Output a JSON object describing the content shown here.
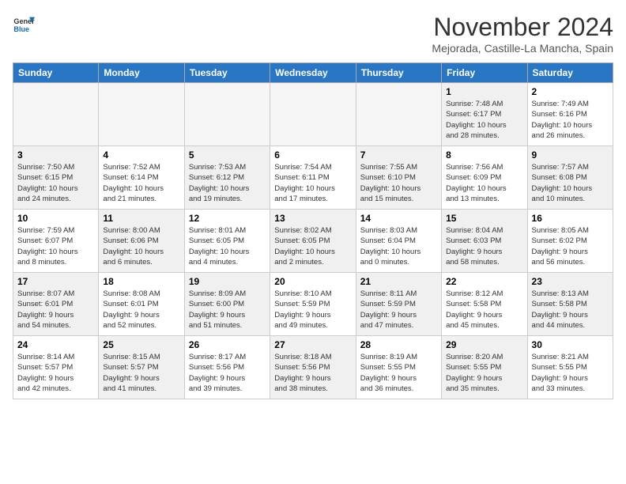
{
  "logo": {
    "line1": "General",
    "line2": "Blue"
  },
  "title": "November 2024",
  "subtitle": "Mejorada, Castille-La Mancha, Spain",
  "headers": [
    "Sunday",
    "Monday",
    "Tuesday",
    "Wednesday",
    "Thursday",
    "Friday",
    "Saturday"
  ],
  "weeks": [
    [
      {
        "day": "",
        "info": "",
        "empty": true
      },
      {
        "day": "",
        "info": "",
        "empty": true
      },
      {
        "day": "",
        "info": "",
        "empty": true
      },
      {
        "day": "",
        "info": "",
        "empty": true
      },
      {
        "day": "",
        "info": "",
        "empty": true
      },
      {
        "day": "1",
        "info": "Sunrise: 7:48 AM\nSunset: 6:17 PM\nDaylight: 10 hours\nand 28 minutes.",
        "shaded": true
      },
      {
        "day": "2",
        "info": "Sunrise: 7:49 AM\nSunset: 6:16 PM\nDaylight: 10 hours\nand 26 minutes.",
        "shaded": false
      }
    ],
    [
      {
        "day": "3",
        "info": "Sunrise: 7:50 AM\nSunset: 6:15 PM\nDaylight: 10 hours\nand 24 minutes.",
        "shaded": true
      },
      {
        "day": "4",
        "info": "Sunrise: 7:52 AM\nSunset: 6:14 PM\nDaylight: 10 hours\nand 21 minutes.",
        "shaded": false
      },
      {
        "day": "5",
        "info": "Sunrise: 7:53 AM\nSunset: 6:12 PM\nDaylight: 10 hours\nand 19 minutes.",
        "shaded": true
      },
      {
        "day": "6",
        "info": "Sunrise: 7:54 AM\nSunset: 6:11 PM\nDaylight: 10 hours\nand 17 minutes.",
        "shaded": false
      },
      {
        "day": "7",
        "info": "Sunrise: 7:55 AM\nSunset: 6:10 PM\nDaylight: 10 hours\nand 15 minutes.",
        "shaded": true
      },
      {
        "day": "8",
        "info": "Sunrise: 7:56 AM\nSunset: 6:09 PM\nDaylight: 10 hours\nand 13 minutes.",
        "shaded": false
      },
      {
        "day": "9",
        "info": "Sunrise: 7:57 AM\nSunset: 6:08 PM\nDaylight: 10 hours\nand 10 minutes.",
        "shaded": true
      }
    ],
    [
      {
        "day": "10",
        "info": "Sunrise: 7:59 AM\nSunset: 6:07 PM\nDaylight: 10 hours\nand 8 minutes.",
        "shaded": false
      },
      {
        "day": "11",
        "info": "Sunrise: 8:00 AM\nSunset: 6:06 PM\nDaylight: 10 hours\nand 6 minutes.",
        "shaded": true
      },
      {
        "day": "12",
        "info": "Sunrise: 8:01 AM\nSunset: 6:05 PM\nDaylight: 10 hours\nand 4 minutes.",
        "shaded": false
      },
      {
        "day": "13",
        "info": "Sunrise: 8:02 AM\nSunset: 6:05 PM\nDaylight: 10 hours\nand 2 minutes.",
        "shaded": true
      },
      {
        "day": "14",
        "info": "Sunrise: 8:03 AM\nSunset: 6:04 PM\nDaylight: 10 hours\nand 0 minutes.",
        "shaded": false
      },
      {
        "day": "15",
        "info": "Sunrise: 8:04 AM\nSunset: 6:03 PM\nDaylight: 9 hours\nand 58 minutes.",
        "shaded": true
      },
      {
        "day": "16",
        "info": "Sunrise: 8:05 AM\nSunset: 6:02 PM\nDaylight: 9 hours\nand 56 minutes.",
        "shaded": false
      }
    ],
    [
      {
        "day": "17",
        "info": "Sunrise: 8:07 AM\nSunset: 6:01 PM\nDaylight: 9 hours\nand 54 minutes.",
        "shaded": true
      },
      {
        "day": "18",
        "info": "Sunrise: 8:08 AM\nSunset: 6:01 PM\nDaylight: 9 hours\nand 52 minutes.",
        "shaded": false
      },
      {
        "day": "19",
        "info": "Sunrise: 8:09 AM\nSunset: 6:00 PM\nDaylight: 9 hours\nand 51 minutes.",
        "shaded": true
      },
      {
        "day": "20",
        "info": "Sunrise: 8:10 AM\nSunset: 5:59 PM\nDaylight: 9 hours\nand 49 minutes.",
        "shaded": false
      },
      {
        "day": "21",
        "info": "Sunrise: 8:11 AM\nSunset: 5:59 PM\nDaylight: 9 hours\nand 47 minutes.",
        "shaded": true
      },
      {
        "day": "22",
        "info": "Sunrise: 8:12 AM\nSunset: 5:58 PM\nDaylight: 9 hours\nand 45 minutes.",
        "shaded": false
      },
      {
        "day": "23",
        "info": "Sunrise: 8:13 AM\nSunset: 5:58 PM\nDaylight: 9 hours\nand 44 minutes.",
        "shaded": true
      }
    ],
    [
      {
        "day": "24",
        "info": "Sunrise: 8:14 AM\nSunset: 5:57 PM\nDaylight: 9 hours\nand 42 minutes.",
        "shaded": false
      },
      {
        "day": "25",
        "info": "Sunrise: 8:15 AM\nSunset: 5:57 PM\nDaylight: 9 hours\nand 41 minutes.",
        "shaded": true
      },
      {
        "day": "26",
        "info": "Sunrise: 8:17 AM\nSunset: 5:56 PM\nDaylight: 9 hours\nand 39 minutes.",
        "shaded": false
      },
      {
        "day": "27",
        "info": "Sunrise: 8:18 AM\nSunset: 5:56 PM\nDaylight: 9 hours\nand 38 minutes.",
        "shaded": true
      },
      {
        "day": "28",
        "info": "Sunrise: 8:19 AM\nSunset: 5:55 PM\nDaylight: 9 hours\nand 36 minutes.",
        "shaded": false
      },
      {
        "day": "29",
        "info": "Sunrise: 8:20 AM\nSunset: 5:55 PM\nDaylight: 9 hours\nand 35 minutes.",
        "shaded": true
      },
      {
        "day": "30",
        "info": "Sunrise: 8:21 AM\nSunset: 5:55 PM\nDaylight: 9 hours\nand 33 minutes.",
        "shaded": false
      }
    ]
  ]
}
